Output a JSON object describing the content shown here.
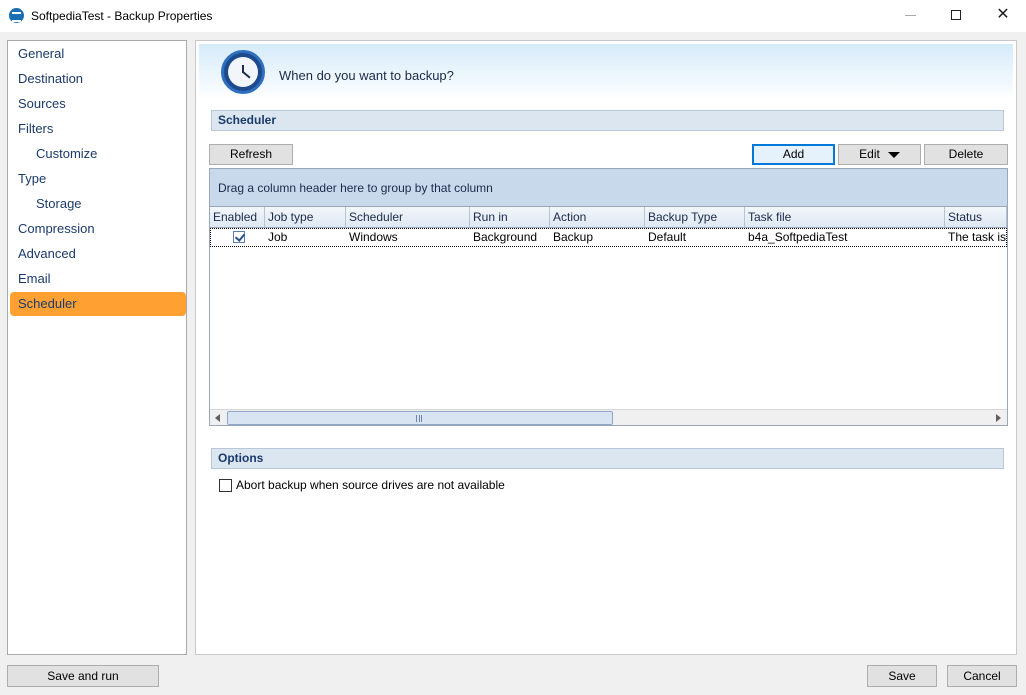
{
  "window": {
    "title": "SoftpediaTest - Backup Properties",
    "controls": {
      "minimize": "—",
      "maximize": "☐",
      "close": "✕"
    }
  },
  "sidebar": {
    "items": [
      {
        "label": "General",
        "sub": false,
        "active": false
      },
      {
        "label": "Destination",
        "sub": false,
        "active": false
      },
      {
        "label": "Sources",
        "sub": false,
        "active": false
      },
      {
        "label": "Filters",
        "sub": false,
        "active": false
      },
      {
        "label": "Customize",
        "sub": true,
        "active": false
      },
      {
        "label": "Type",
        "sub": false,
        "active": false
      },
      {
        "label": "Storage",
        "sub": true,
        "active": false
      },
      {
        "label": "Compression",
        "sub": false,
        "active": false
      },
      {
        "label": "Advanced",
        "sub": false,
        "active": false
      },
      {
        "label": "Email",
        "sub": false,
        "active": false
      },
      {
        "label": "Scheduler",
        "sub": false,
        "active": true
      }
    ],
    "active_color": "#ffa033"
  },
  "header": {
    "question": "When do you want to backup?",
    "icon": "clock-icon"
  },
  "scheduler": {
    "section_title": "Scheduler",
    "buttons": {
      "refresh": "Refresh",
      "add": "Add",
      "edit": "Edit",
      "delete": "Delete"
    },
    "grid": {
      "group_hint": "Drag a column header here to group by that column",
      "columns": [
        "Enabled",
        "Job type",
        "Scheduler",
        "Run in",
        "Action",
        "Backup Type",
        "Task file",
        "Status"
      ],
      "rows": [
        {
          "enabled": true,
          "job_type": "Job",
          "scheduler": "Windows",
          "run_in": "Background",
          "action": "Backup",
          "backup_type": "Default",
          "task_file": "b4a_SoftpediaTest",
          "status": "The task is r"
        }
      ]
    }
  },
  "options": {
    "section_title": "Options",
    "abort_label": "Abort backup when source drives are not available",
    "abort_checked": false
  },
  "footer": {
    "save_and_run": "Save and run",
    "save": "Save",
    "cancel": "Cancel"
  }
}
